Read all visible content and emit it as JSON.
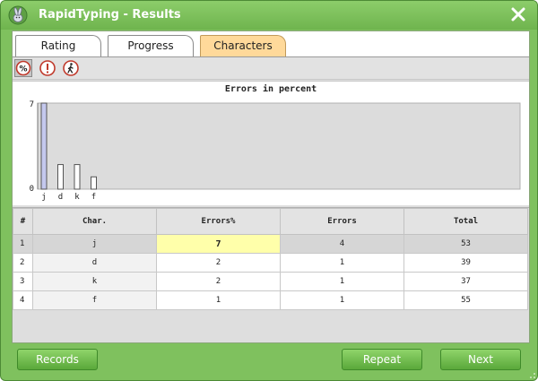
{
  "window": {
    "title": "RapidTyping - Results"
  },
  "tabs": [
    {
      "label": "Rating",
      "active": false
    },
    {
      "label": "Progress",
      "active": false
    },
    {
      "label": "Characters",
      "active": true
    }
  ],
  "toolbar": {
    "buttons": [
      {
        "icon": "percent-icon",
        "pressed": true
      },
      {
        "icon": "exclamation-icon",
        "pressed": false
      },
      {
        "icon": "walking-icon",
        "pressed": false
      }
    ]
  },
  "chart_title": "Errors in percent",
  "chart_data": {
    "type": "bar",
    "title": "Errors in percent",
    "categories": [
      "j",
      "d",
      "k",
      "f"
    ],
    "values": [
      7,
      2,
      2,
      1
    ],
    "ylim": [
      0,
      7
    ],
    "yticks": [
      "0",
      "7"
    ],
    "xlabel": "",
    "ylabel": "",
    "grid": false,
    "highlighted_index": 0,
    "colors": {
      "highlight": "#c4c8ee",
      "bar": "#ffffff",
      "stroke": "#555555"
    }
  },
  "table": {
    "headers": [
      "#",
      "Char.",
      "Errors%",
      "Errors",
      "Total"
    ],
    "rows": [
      [
        "1",
        "j",
        "7",
        "4",
        "53"
      ],
      [
        "2",
        "d",
        "2",
        "1",
        "39"
      ],
      [
        "3",
        "k",
        "2",
        "1",
        "37"
      ],
      [
        "4",
        "f",
        "1",
        "1",
        "55"
      ]
    ],
    "selected_row": 0
  },
  "footer": {
    "records_label": "Records",
    "repeat_label": "Repeat",
    "next_label": "Next"
  },
  "colors": {
    "window_green": "#7fc15e",
    "active_tab": "#ffd99a",
    "highlight_cell": "#ffffaa"
  }
}
